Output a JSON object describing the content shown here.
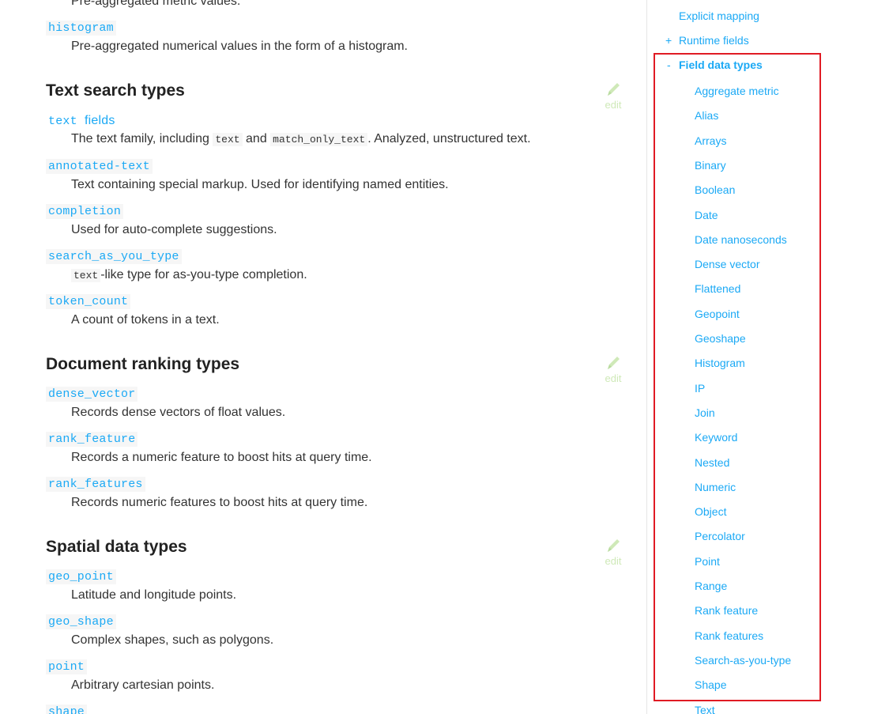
{
  "main": {
    "top_partial_desc": "Pre-aggregated metric values.",
    "histogram": {
      "term": "histogram",
      "desc": "Pre-aggregated numerical values in the form of a histogram."
    },
    "sections": {
      "text_search": {
        "heading": "Text search types",
        "edit": "edit",
        "text_fields": {
          "term": "text",
          "suffix": "fields",
          "desc_a": "The text family, including",
          "code_a": "text",
          "desc_b": "and",
          "code_b": "match_only_text",
          "desc_c": ". Analyzed, unstructured text."
        },
        "annotated_text": {
          "term": "annotated-text",
          "desc": "Text containing special markup. Used for identifying named entities."
        },
        "completion": {
          "term": "completion",
          "desc": "Used for auto-complete suggestions."
        },
        "search_as_you_type": {
          "term": "search_as_you_type",
          "code": "text",
          "desc": "-like type for as-you-type completion."
        },
        "token_count": {
          "term": "token_count",
          "desc": "A count of tokens in a text."
        }
      },
      "doc_ranking": {
        "heading": "Document ranking types",
        "edit": "edit",
        "dense_vector": {
          "term": "dense_vector",
          "desc": "Records dense vectors of float values."
        },
        "rank_feature": {
          "term": "rank_feature",
          "desc": "Records a numeric feature to boost hits at query time."
        },
        "rank_features": {
          "term": "rank_features",
          "desc": "Records numeric features to boost hits at query time."
        }
      },
      "spatial": {
        "heading": "Spatial data types",
        "edit": "edit",
        "geo_point": {
          "term": "geo_point",
          "desc": "Latitude and longitude points."
        },
        "geo_shape": {
          "term": "geo_shape",
          "desc": "Complex shapes, such as polygons."
        },
        "point": {
          "term": "point",
          "desc": "Arbitrary cartesian points."
        },
        "shape": {
          "term": "shape"
        }
      }
    }
  },
  "sidebar": {
    "explicit_mapping": "Explicit mapping",
    "runtime_fields": {
      "toggle": "+",
      "label": "Runtime fields"
    },
    "field_data_types": {
      "toggle": "-",
      "label": "Field data types"
    },
    "items": [
      "Aggregate metric",
      "Alias",
      "Arrays",
      "Binary",
      "Boolean",
      "Date",
      "Date nanoseconds",
      "Dense vector",
      "Flattened",
      "Geopoint",
      "Geoshape",
      "Histogram",
      "IP",
      "Join",
      "Keyword",
      "Nested",
      "Numeric",
      "Object",
      "Percolator",
      "Point",
      "Range",
      "Rank feature",
      "Rank features",
      "Search-as-you-type",
      "Shape",
      "Text"
    ]
  },
  "colors": {
    "link": "#1ba9f5",
    "highlight_border": "#e01b24",
    "edit_icon": "#cfe9b8"
  }
}
